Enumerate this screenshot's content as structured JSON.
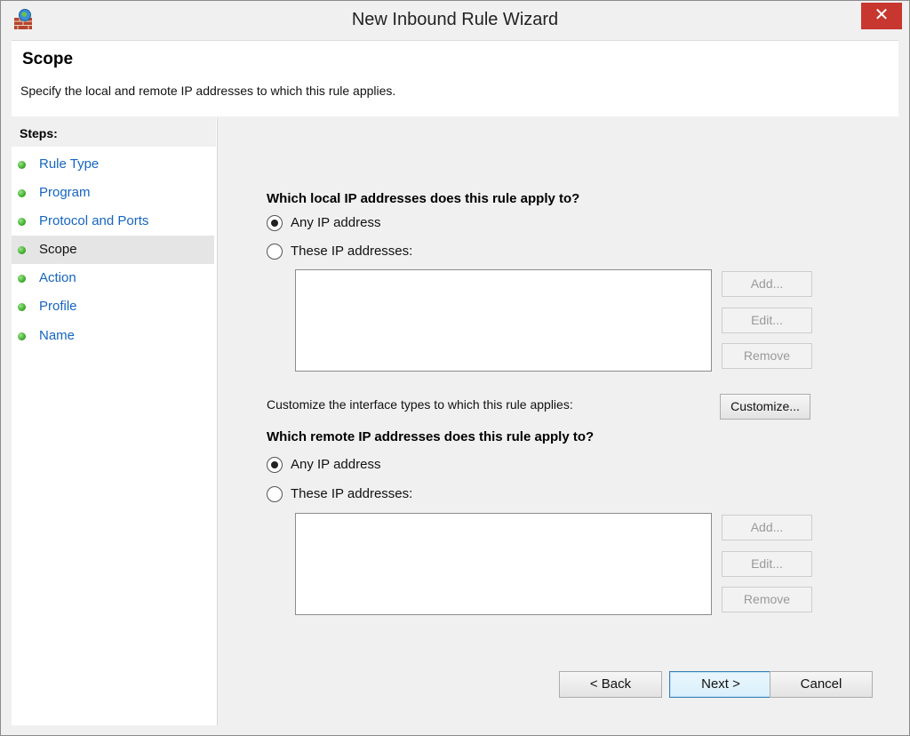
{
  "window": {
    "title": "New Inbound Rule Wizard",
    "close_glyph": "✕",
    "icon": "firewall-icon"
  },
  "header": {
    "title": "Scope",
    "description": "Specify the local and remote IP addresses to which this rule applies."
  },
  "steps": {
    "label": "Steps:",
    "items": [
      {
        "label": "Rule Type",
        "active": false
      },
      {
        "label": "Program",
        "active": false
      },
      {
        "label": "Protocol and Ports",
        "active": false
      },
      {
        "label": "Scope",
        "active": true
      },
      {
        "label": "Action",
        "active": false
      },
      {
        "label": "Profile",
        "active": false
      },
      {
        "label": "Name",
        "active": false
      }
    ]
  },
  "local": {
    "heading": "Which local IP addresses does this rule apply to?",
    "any_label": "Any IP address",
    "these_label": "These IP addresses:",
    "selected": "any",
    "add_label": "Add...",
    "edit_label": "Edit...",
    "remove_label": "Remove"
  },
  "customize": {
    "text": "Customize the interface types to which this rule applies:",
    "button_label": "Customize..."
  },
  "remote": {
    "heading": "Which remote IP addresses does this rule apply to?",
    "any_label": "Any IP address",
    "these_label": "These IP addresses:",
    "selected": "any",
    "add_label": "Add...",
    "edit_label": "Edit...",
    "remove_label": "Remove"
  },
  "footer": {
    "back_label": "< Back",
    "next_label": "Next >",
    "cancel_label": "Cancel"
  },
  "colors": {
    "link": "#1565c0",
    "close": "#c7372f",
    "step_dot": "#3fae2c"
  }
}
